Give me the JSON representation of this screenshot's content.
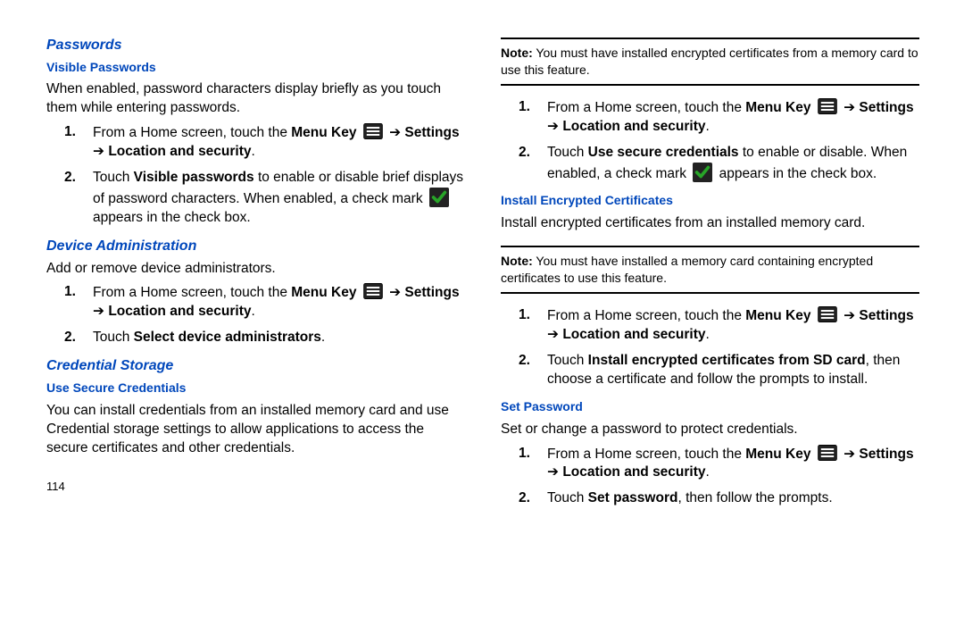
{
  "page_number": "114",
  "arrow": "➔",
  "sec_passwords": {
    "title": "Passwords",
    "visible_passwords": {
      "title": "Visible Passwords",
      "intro": "When enabled, password characters display briefly as you touch them while entering passwords.",
      "s1_a": "From a Home screen, touch the ",
      "menu_key": "Menu Key",
      "settings": "Settings",
      "loc_sec": "Location and security",
      "s2_a": "Touch ",
      "s2_b": "Visible passwords",
      "s2_c": " to enable or disable brief displays of password characters. When enabled, a check mark ",
      "s2_d": " appears in the check box."
    }
  },
  "sec_device_admin": {
    "title": "Device Administration",
    "intro": "Add or remove device administrators.",
    "s1_a": "From a Home screen, touch the ",
    "menu_key": "Menu Key",
    "settings": "Settings",
    "loc_sec": "Location and security",
    "s2_a": "Touch ",
    "s2_b": "Select device administrators"
  },
  "sec_cred_storage": {
    "title": "Credential Storage",
    "use_secure": {
      "title": "Use Secure Credentials",
      "intro": "You can install credentials from an installed memory card and use Credential storage settings to allow applications to access the secure certificates and other credentials.",
      "note_label": "Note:",
      "note": "You must have installed encrypted certificates from a memory card to use this feature.",
      "s1_a": "From a Home screen, touch the ",
      "menu_key": "Menu Key",
      "settings": "Settings",
      "loc_sec": "Location and security",
      "s2_a": "Touch ",
      "s2_b": "Use secure credentials",
      "s2_c": " to enable or disable. When enabled, a check mark ",
      "s2_d": " appears in the check box."
    },
    "install_enc": {
      "title": "Install Encrypted Certificates",
      "intro": "Install encrypted certificates from an installed memory card.",
      "note_label": "Note:",
      "note": "You must have installed a memory card containing encrypted certificates to use this feature.",
      "s1_a": "From a Home screen, touch the ",
      "menu_key": "Menu Key",
      "settings": "Settings",
      "loc_sec": "Location and security",
      "s2_a": "Touch ",
      "s2_b": "Install encrypted certificates from SD card",
      "s2_c": ", then choose a certificate and follow the prompts to install."
    },
    "set_password": {
      "title": "Set Password",
      "intro": "Set or change a password to protect credentials.",
      "s1_a": "From a Home screen, touch the ",
      "menu_key": "Menu Key",
      "settings": "Settings",
      "loc_sec": "Location and security",
      "s2_a": "Touch ",
      "s2_b": "Set password",
      "s2_c": ", then follow the prompts."
    }
  }
}
